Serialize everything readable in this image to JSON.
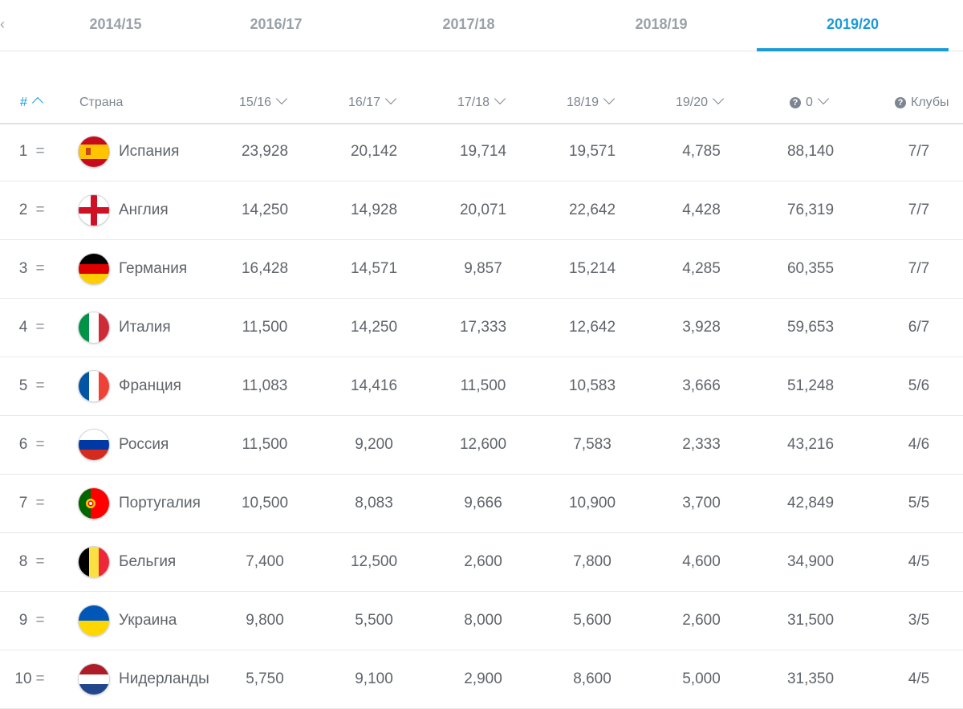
{
  "tabs": [
    {
      "label": "2014/15",
      "active": false
    },
    {
      "label": "2016/17",
      "active": false
    },
    {
      "label": "2017/18",
      "active": false
    },
    {
      "label": "2018/19",
      "active": false
    },
    {
      "label": "2019/20",
      "active": true
    }
  ],
  "accent_color": "#1a9bd8",
  "table": {
    "headers": {
      "rank": "#",
      "country": "Страна",
      "s1516": "15/16",
      "s1617": "16/17",
      "s1718": "17/18",
      "s1819": "18/19",
      "s1920": "19/20",
      "total": "0",
      "clubs": "Клубы"
    },
    "rows": [
      {
        "rank": "1",
        "change": "=",
        "flag": "spain-flag-icon",
        "country": "Испания",
        "s1516": "23,928",
        "s1617": "20,142",
        "s1718": "19,714",
        "s1819": "19,571",
        "s1920": "4,785",
        "total": "88,140",
        "clubs": "7/7"
      },
      {
        "rank": "2",
        "change": "=",
        "flag": "england-flag-icon",
        "country": "Англия",
        "s1516": "14,250",
        "s1617": "14,928",
        "s1718": "20,071",
        "s1819": "22,642",
        "s1920": "4,428",
        "total": "76,319",
        "clubs": "7/7"
      },
      {
        "rank": "3",
        "change": "=",
        "flag": "germany-flag-icon",
        "country": "Германия",
        "s1516": "16,428",
        "s1617": "14,571",
        "s1718": "9,857",
        "s1819": "15,214",
        "s1920": "4,285",
        "total": "60,355",
        "clubs": "7/7"
      },
      {
        "rank": "4",
        "change": "=",
        "flag": "italy-flag-icon",
        "country": "Италия",
        "s1516": "11,500",
        "s1617": "14,250",
        "s1718": "17,333",
        "s1819": "12,642",
        "s1920": "3,928",
        "total": "59,653",
        "clubs": "6/7"
      },
      {
        "rank": "5",
        "change": "=",
        "flag": "france-flag-icon",
        "country": "Франция",
        "s1516": "11,083",
        "s1617": "14,416",
        "s1718": "11,500",
        "s1819": "10,583",
        "s1920": "3,666",
        "total": "51,248",
        "clubs": "5/6"
      },
      {
        "rank": "6",
        "change": "=",
        "flag": "russia-flag-icon",
        "country": "Россия",
        "s1516": "11,500",
        "s1617": "9,200",
        "s1718": "12,600",
        "s1819": "7,583",
        "s1920": "2,333",
        "total": "43,216",
        "clubs": "4/6"
      },
      {
        "rank": "7",
        "change": "=",
        "flag": "portugal-flag-icon",
        "country": "Португалия",
        "s1516": "10,500",
        "s1617": "8,083",
        "s1718": "9,666",
        "s1819": "10,900",
        "s1920": "3,700",
        "total": "42,849",
        "clubs": "5/5"
      },
      {
        "rank": "8",
        "change": "=",
        "flag": "belgium-flag-icon",
        "country": "Бельгия",
        "s1516": "7,400",
        "s1617": "12,500",
        "s1718": "2,600",
        "s1819": "7,800",
        "s1920": "4,600",
        "total": "34,900",
        "clubs": "4/5"
      },
      {
        "rank": "9",
        "change": "=",
        "flag": "ukraine-flag-icon",
        "country": "Украина",
        "s1516": "9,800",
        "s1617": "5,500",
        "s1718": "8,000",
        "s1819": "5,600",
        "s1920": "2,600",
        "total": "31,500",
        "clubs": "3/5"
      },
      {
        "rank": "10",
        "change": "=",
        "flag": "netherlands-flag-icon",
        "country": "Нидерланды",
        "s1516": "5,750",
        "s1617": "9,100",
        "s1718": "2,900",
        "s1819": "8,600",
        "s1920": "5,000",
        "total": "31,350",
        "clubs": "4/5"
      }
    ]
  }
}
